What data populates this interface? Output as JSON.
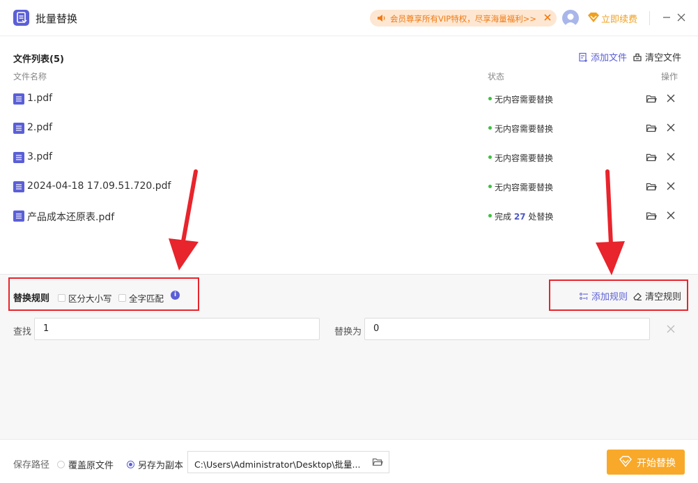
{
  "app": {
    "title": "批量替换"
  },
  "header": {
    "vip_banner": "会员尊享所有VIP特权，尽享海量福利>>",
    "renew_label": "立即续费"
  },
  "file_list": {
    "title": "文件列表(5)",
    "add_label": "添加文件",
    "clear_label": "清空文件",
    "columns": [
      "文件名称",
      "状态",
      "操作"
    ],
    "rows": [
      {
        "name": "1.pdf",
        "status": "无内容需要替换"
      },
      {
        "name": "2.pdf",
        "status": "无内容需要替换"
      },
      {
        "name": "3.pdf",
        "status": "无内容需要替换"
      },
      {
        "name": "2024-04-18 17.09.51.720.pdf",
        "status": "无内容需要替换"
      },
      {
        "name": "产品成本还原表.pdf",
        "status_prefix": "完成",
        "status_count": "27",
        "status_suffix": "处替换"
      }
    ]
  },
  "rules": {
    "title": "替换规则",
    "case_sensitive": "区分大小写",
    "whole_word": "全字匹配",
    "info": "i",
    "add_label": "添加规则",
    "clear_label": "清空规则",
    "find_label": "查找",
    "find_value": "1",
    "replace_label": "替换为",
    "replace_value": "0"
  },
  "footer": {
    "save_label": "保存路径",
    "overwrite_label": "覆盖原文件",
    "save_copy_label": "另存为副本",
    "save_mode": "另存为副本",
    "path": "C:\\Users\\Administrator\\Desktop\\批量...",
    "start_label": "开始替换"
  },
  "colors": {
    "accent": "#5b5fd6",
    "status_ok": "#3fbf3f",
    "start_button": "#f8a92a",
    "highlight": "#e8242c"
  }
}
